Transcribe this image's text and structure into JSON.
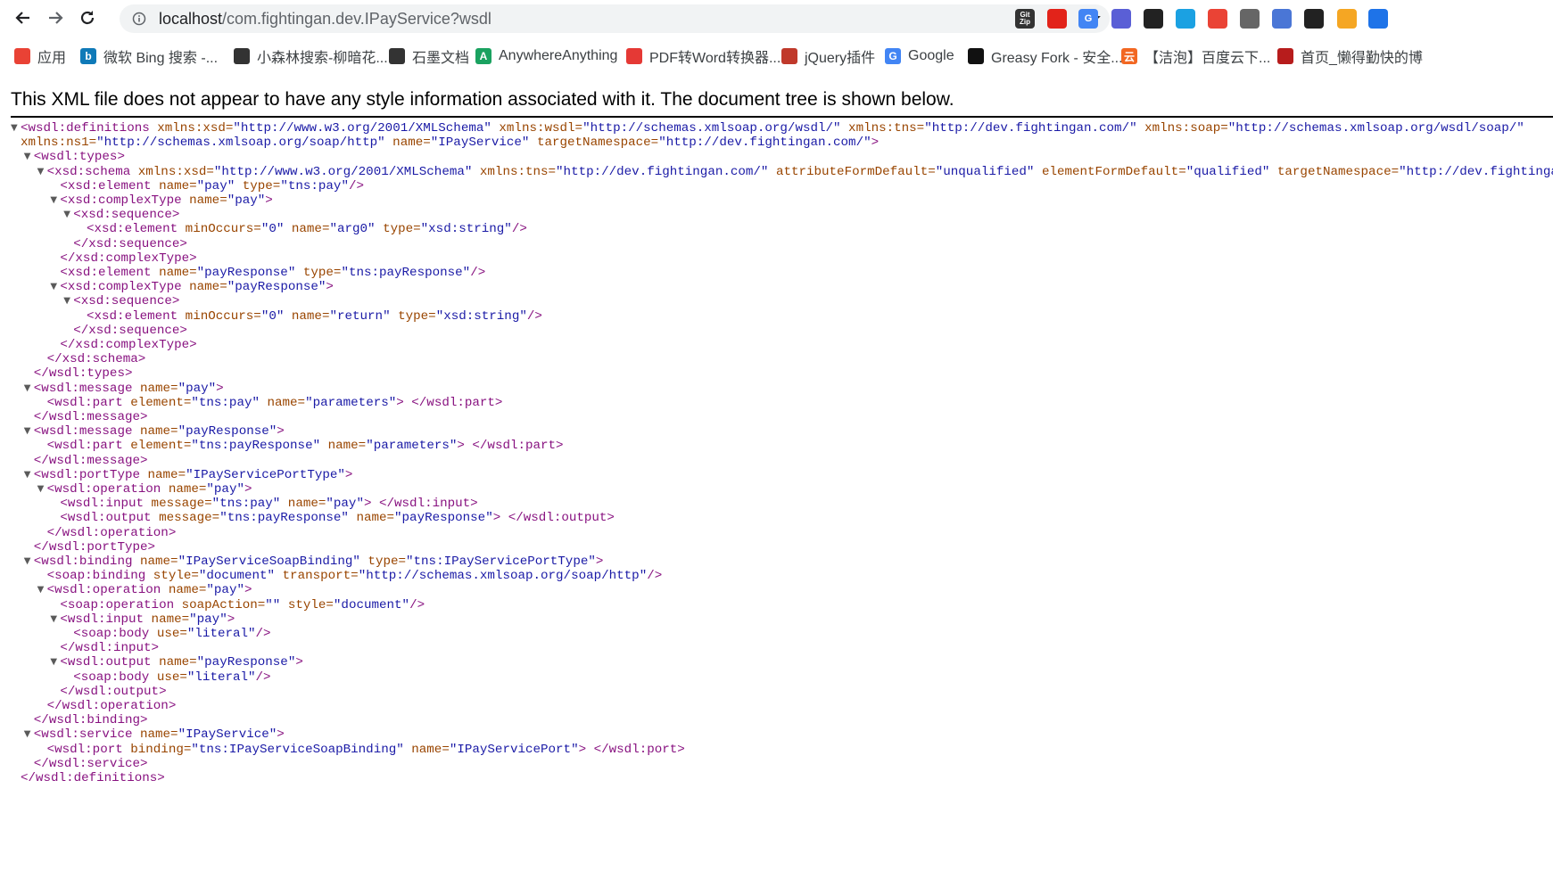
{
  "browser": {
    "url_host": "localhost",
    "url_rest": "/com.fightingan.dev.IPayService?wsdl"
  },
  "extensions": [
    {
      "icon": "gitzip-icon",
      "text": "Git Zip",
      "color": "#333333"
    },
    {
      "icon": "adblock-icon",
      "text": "",
      "color": "#e2231a"
    },
    {
      "icon": "translate-icon",
      "text": "G",
      "color": "#4285f4"
    },
    {
      "icon": "checkmark-circle-icon",
      "text": "",
      "color": "#5a5fd6"
    },
    {
      "icon": "gamepad-icon",
      "text": "",
      "color": "#222222"
    },
    {
      "icon": "screenshot-icon",
      "text": "",
      "color": "#1ba1e2"
    },
    {
      "icon": "location-pin-icon",
      "text": "",
      "color": "#ea4335"
    },
    {
      "icon": "infinity-icon",
      "text": "",
      "color": "#666666"
    },
    {
      "icon": "half-circle-icon",
      "text": "",
      "color": "#4a76d6"
    },
    {
      "icon": "mask-icon",
      "text": "",
      "color": "#222222"
    },
    {
      "icon": "tampermonkey-icon",
      "text": "",
      "color": "#f5a623"
    },
    {
      "icon": "shield-icon",
      "text": "",
      "color": "#1e73e8"
    }
  ],
  "bookmarks": [
    {
      "label": "应用",
      "icon": "apps-grid-icon",
      "color": "#e94235",
      "glyph": ""
    },
    {
      "label": "微软 Bing 搜索 -...",
      "icon": "bing-icon",
      "color": "#0f7ab8",
      "glyph": "b"
    },
    {
      "label": "小森林搜索-柳暗花...",
      "icon": "globe-icon",
      "color": "#333333",
      "glyph": ""
    },
    {
      "label": "石墨文档",
      "icon": "shimo-icon",
      "color": "#333333",
      "glyph": ""
    },
    {
      "label": "AnywhereAnything",
      "icon": "anywhere-icon",
      "color": "#1aa260",
      "glyph": "A"
    },
    {
      "label": "PDF转Word转换器...",
      "icon": "pdf-icon",
      "color": "#e53935",
      "glyph": ""
    },
    {
      "label": "jQuery插件",
      "icon": "jquery-icon",
      "color": "#c0392b",
      "glyph": ""
    },
    {
      "label": "Google",
      "icon": "google-icon",
      "color": "#4285f4",
      "glyph": "G"
    },
    {
      "label": "Greasy Fork - 安全...",
      "icon": "greasyfork-icon",
      "color": "#111111",
      "glyph": ""
    },
    {
      "label": "【洁泡】百度云下...",
      "icon": "baidu-cloud-icon",
      "color": "#f26722",
      "glyph": "云"
    },
    {
      "label": "首页_懒得勤快的博",
      "icon": "blog-icon",
      "color": "#b71c1c",
      "glyph": ""
    }
  ],
  "notice": "This XML file does not appear to have any style information associated with it. The document tree is shown below.",
  "xml_lines": [
    {
      "indent": 0,
      "toggle": true,
      "parts": [
        [
          "tg",
          "<wsdl:definitions"
        ],
        [
          "an",
          " xmlns:xsd="
        ],
        [
          "av",
          "\"http://www.w3.org/2001/XMLSchema\""
        ],
        [
          "an",
          " xmlns:wsdl="
        ],
        [
          "av",
          "\"http://schemas.xmlsoap.org/wsdl/\""
        ],
        [
          "an",
          " xmlns:tns="
        ],
        [
          "av",
          "\"http://dev.fightingan.com/\""
        ],
        [
          "an",
          " xmlns:soap="
        ],
        [
          "av",
          "\"http://schemas.xmlsoap.org/wsdl/soap/\""
        ]
      ]
    },
    {
      "indent": 0,
      "toggle": false,
      "parts": [
        [
          "an",
          "xmlns:ns1="
        ],
        [
          "av",
          "\"http://schemas.xmlsoap.org/soap/http\""
        ],
        [
          "an",
          " name="
        ],
        [
          "av",
          "\"IPayService\""
        ],
        [
          "an",
          " targetNamespace="
        ],
        [
          "av",
          "\"http://dev.fightingan.com/\""
        ],
        [
          "tg",
          ">"
        ]
      ]
    },
    {
      "indent": 1,
      "toggle": true,
      "parts": [
        [
          "tg",
          "<wsdl:types>"
        ]
      ]
    },
    {
      "indent": 2,
      "toggle": true,
      "parts": [
        [
          "tg",
          "<xsd:schema"
        ],
        [
          "an",
          " xmlns:xsd="
        ],
        [
          "av",
          "\"http://www.w3.org/2001/XMLSchema\""
        ],
        [
          "an",
          " xmlns:tns="
        ],
        [
          "av",
          "\"http://dev.fightingan.com/\""
        ],
        [
          "an",
          " attributeFormDefault="
        ],
        [
          "av",
          "\"unqualified\""
        ],
        [
          "an",
          " elementFormDefault="
        ],
        [
          "av",
          "\"qualified\""
        ],
        [
          "an",
          " targetNamespace="
        ],
        [
          "av",
          "\"http://dev.fightingan.com/\""
        ],
        [
          "tg",
          ">"
        ]
      ]
    },
    {
      "indent": 3,
      "toggle": false,
      "parts": [
        [
          "tg",
          "<xsd:element"
        ],
        [
          "an",
          " name="
        ],
        [
          "av",
          "\"pay\""
        ],
        [
          "an",
          " type="
        ],
        [
          "av",
          "\"tns:pay\""
        ],
        [
          "tg",
          "/>"
        ]
      ]
    },
    {
      "indent": 3,
      "toggle": true,
      "parts": [
        [
          "tg",
          "<xsd:complexType"
        ],
        [
          "an",
          " name="
        ],
        [
          "av",
          "\"pay\""
        ],
        [
          "tg",
          ">"
        ]
      ]
    },
    {
      "indent": 4,
      "toggle": true,
      "parts": [
        [
          "tg",
          "<xsd:sequence>"
        ]
      ]
    },
    {
      "indent": 5,
      "toggle": false,
      "parts": [
        [
          "tg",
          "<xsd:element"
        ],
        [
          "an",
          " minOccurs="
        ],
        [
          "av",
          "\"0\""
        ],
        [
          "an",
          " name="
        ],
        [
          "av",
          "\"arg0\""
        ],
        [
          "an",
          " type="
        ],
        [
          "av",
          "\"xsd:string\""
        ],
        [
          "tg",
          "/>"
        ]
      ]
    },
    {
      "indent": 4,
      "toggle": false,
      "parts": [
        [
          "tg",
          "</xsd:sequence>"
        ]
      ]
    },
    {
      "indent": 3,
      "toggle": false,
      "parts": [
        [
          "tg",
          "</xsd:complexType>"
        ]
      ]
    },
    {
      "indent": 3,
      "toggle": false,
      "parts": [
        [
          "tg",
          "<xsd:element"
        ],
        [
          "an",
          " name="
        ],
        [
          "av",
          "\"payResponse\""
        ],
        [
          "an",
          " type="
        ],
        [
          "av",
          "\"tns:payResponse\""
        ],
        [
          "tg",
          "/>"
        ]
      ]
    },
    {
      "indent": 3,
      "toggle": true,
      "parts": [
        [
          "tg",
          "<xsd:complexType"
        ],
        [
          "an",
          " name="
        ],
        [
          "av",
          "\"payResponse\""
        ],
        [
          "tg",
          ">"
        ]
      ]
    },
    {
      "indent": 4,
      "toggle": true,
      "parts": [
        [
          "tg",
          "<xsd:sequence>"
        ]
      ]
    },
    {
      "indent": 5,
      "toggle": false,
      "parts": [
        [
          "tg",
          "<xsd:element"
        ],
        [
          "an",
          " minOccurs="
        ],
        [
          "av",
          "\"0\""
        ],
        [
          "an",
          " name="
        ],
        [
          "av",
          "\"return\""
        ],
        [
          "an",
          " type="
        ],
        [
          "av",
          "\"xsd:string\""
        ],
        [
          "tg",
          "/>"
        ]
      ]
    },
    {
      "indent": 4,
      "toggle": false,
      "parts": [
        [
          "tg",
          "</xsd:sequence>"
        ]
      ]
    },
    {
      "indent": 3,
      "toggle": false,
      "parts": [
        [
          "tg",
          "</xsd:complexType>"
        ]
      ]
    },
    {
      "indent": 2,
      "toggle": false,
      "parts": [
        [
          "tg",
          "</xsd:schema>"
        ]
      ]
    },
    {
      "indent": 1,
      "toggle": false,
      "parts": [
        [
          "tg",
          "</wsdl:types>"
        ]
      ]
    },
    {
      "indent": 1,
      "toggle": true,
      "parts": [
        [
          "tg",
          "<wsdl:message"
        ],
        [
          "an",
          " name="
        ],
        [
          "av",
          "\"pay\""
        ],
        [
          "tg",
          ">"
        ]
      ]
    },
    {
      "indent": 2,
      "toggle": false,
      "parts": [
        [
          "tg",
          "<wsdl:part"
        ],
        [
          "an",
          " element="
        ],
        [
          "av",
          "\"tns:pay\""
        ],
        [
          "an",
          " name="
        ],
        [
          "av",
          "\"parameters\""
        ],
        [
          "tg",
          "> </wsdl:part>"
        ]
      ]
    },
    {
      "indent": 1,
      "toggle": false,
      "parts": [
        [
          "tg",
          "</wsdl:message>"
        ]
      ]
    },
    {
      "indent": 1,
      "toggle": true,
      "parts": [
        [
          "tg",
          "<wsdl:message"
        ],
        [
          "an",
          " name="
        ],
        [
          "av",
          "\"payResponse\""
        ],
        [
          "tg",
          ">"
        ]
      ]
    },
    {
      "indent": 2,
      "toggle": false,
      "parts": [
        [
          "tg",
          "<wsdl:part"
        ],
        [
          "an",
          " element="
        ],
        [
          "av",
          "\"tns:payResponse\""
        ],
        [
          "an",
          " name="
        ],
        [
          "av",
          "\"parameters\""
        ],
        [
          "tg",
          "> </wsdl:part>"
        ]
      ]
    },
    {
      "indent": 1,
      "toggle": false,
      "parts": [
        [
          "tg",
          "</wsdl:message>"
        ]
      ]
    },
    {
      "indent": 1,
      "toggle": true,
      "parts": [
        [
          "tg",
          "<wsdl:portType"
        ],
        [
          "an",
          " name="
        ],
        [
          "av",
          "\"IPayServicePortType\""
        ],
        [
          "tg",
          ">"
        ]
      ]
    },
    {
      "indent": 2,
      "toggle": true,
      "parts": [
        [
          "tg",
          "<wsdl:operation"
        ],
        [
          "an",
          " name="
        ],
        [
          "av",
          "\"pay\""
        ],
        [
          "tg",
          ">"
        ]
      ]
    },
    {
      "indent": 3,
      "toggle": false,
      "parts": [
        [
          "tg",
          "<wsdl:input"
        ],
        [
          "an",
          " message="
        ],
        [
          "av",
          "\"tns:pay\""
        ],
        [
          "an",
          " name="
        ],
        [
          "av",
          "\"pay\""
        ],
        [
          "tg",
          "> </wsdl:input>"
        ]
      ]
    },
    {
      "indent": 3,
      "toggle": false,
      "parts": [
        [
          "tg",
          "<wsdl:output"
        ],
        [
          "an",
          " message="
        ],
        [
          "av",
          "\"tns:payResponse\""
        ],
        [
          "an",
          " name="
        ],
        [
          "av",
          "\"payResponse\""
        ],
        [
          "tg",
          "> </wsdl:output>"
        ]
      ]
    },
    {
      "indent": 2,
      "toggle": false,
      "parts": [
        [
          "tg",
          "</wsdl:operation>"
        ]
      ]
    },
    {
      "indent": 1,
      "toggle": false,
      "parts": [
        [
          "tg",
          "</wsdl:portType>"
        ]
      ]
    },
    {
      "indent": 1,
      "toggle": true,
      "parts": [
        [
          "tg",
          "<wsdl:binding"
        ],
        [
          "an",
          " name="
        ],
        [
          "av",
          "\"IPayServiceSoapBinding\""
        ],
        [
          "an",
          " type="
        ],
        [
          "av",
          "\"tns:IPayServicePortType\""
        ],
        [
          "tg",
          ">"
        ]
      ]
    },
    {
      "indent": 2,
      "toggle": false,
      "parts": [
        [
          "tg",
          "<soap:binding"
        ],
        [
          "an",
          " style="
        ],
        [
          "av",
          "\"document\""
        ],
        [
          "an",
          " transport="
        ],
        [
          "av",
          "\"http://schemas.xmlsoap.org/soap/http\""
        ],
        [
          "tg",
          "/>"
        ]
      ]
    },
    {
      "indent": 2,
      "toggle": true,
      "parts": [
        [
          "tg",
          "<wsdl:operation"
        ],
        [
          "an",
          " name="
        ],
        [
          "av",
          "\"pay\""
        ],
        [
          "tg",
          ">"
        ]
      ]
    },
    {
      "indent": 3,
      "toggle": false,
      "parts": [
        [
          "tg",
          "<soap:operation"
        ],
        [
          "an",
          " soapAction="
        ],
        [
          "av",
          "\"\""
        ],
        [
          "an",
          " style="
        ],
        [
          "av",
          "\"document\""
        ],
        [
          "tg",
          "/>"
        ]
      ]
    },
    {
      "indent": 3,
      "toggle": true,
      "parts": [
        [
          "tg",
          "<wsdl:input"
        ],
        [
          "an",
          " name="
        ],
        [
          "av",
          "\"pay\""
        ],
        [
          "tg",
          ">"
        ]
      ]
    },
    {
      "indent": 4,
      "toggle": false,
      "parts": [
        [
          "tg",
          "<soap:body"
        ],
        [
          "an",
          " use="
        ],
        [
          "av",
          "\"literal\""
        ],
        [
          "tg",
          "/>"
        ]
      ]
    },
    {
      "indent": 3,
      "toggle": false,
      "parts": [
        [
          "tg",
          "</wsdl:input>"
        ]
      ]
    },
    {
      "indent": 3,
      "toggle": true,
      "parts": [
        [
          "tg",
          "<wsdl:output"
        ],
        [
          "an",
          " name="
        ],
        [
          "av",
          "\"payResponse\""
        ],
        [
          "tg",
          ">"
        ]
      ]
    },
    {
      "indent": 4,
      "toggle": false,
      "parts": [
        [
          "tg",
          "<soap:body"
        ],
        [
          "an",
          " use="
        ],
        [
          "av",
          "\"literal\""
        ],
        [
          "tg",
          "/>"
        ]
      ]
    },
    {
      "indent": 3,
      "toggle": false,
      "parts": [
        [
          "tg",
          "</wsdl:output>"
        ]
      ]
    },
    {
      "indent": 2,
      "toggle": false,
      "parts": [
        [
          "tg",
          "</wsdl:operation>"
        ]
      ]
    },
    {
      "indent": 1,
      "toggle": false,
      "parts": [
        [
          "tg",
          "</wsdl:binding>"
        ]
      ]
    },
    {
      "indent": 1,
      "toggle": true,
      "parts": [
        [
          "tg",
          "<wsdl:service"
        ],
        [
          "an",
          " name="
        ],
        [
          "av",
          "\"IPayService\""
        ],
        [
          "tg",
          ">"
        ]
      ]
    },
    {
      "indent": 2,
      "toggle": false,
      "parts": [
        [
          "tg",
          "<wsdl:port"
        ],
        [
          "an",
          " binding="
        ],
        [
          "av",
          "\"tns:IPayServiceSoapBinding\""
        ],
        [
          "an",
          " name="
        ],
        [
          "av",
          "\"IPayServicePort\""
        ],
        [
          "tg",
          "> </wsdl:port>"
        ]
      ]
    },
    {
      "indent": 1,
      "toggle": false,
      "parts": [
        [
          "tg",
          "</wsdl:service>"
        ]
      ]
    },
    {
      "indent": 0,
      "toggle": false,
      "parts": [
        [
          "tg",
          "</wsdl:definitions>"
        ]
      ]
    }
  ]
}
